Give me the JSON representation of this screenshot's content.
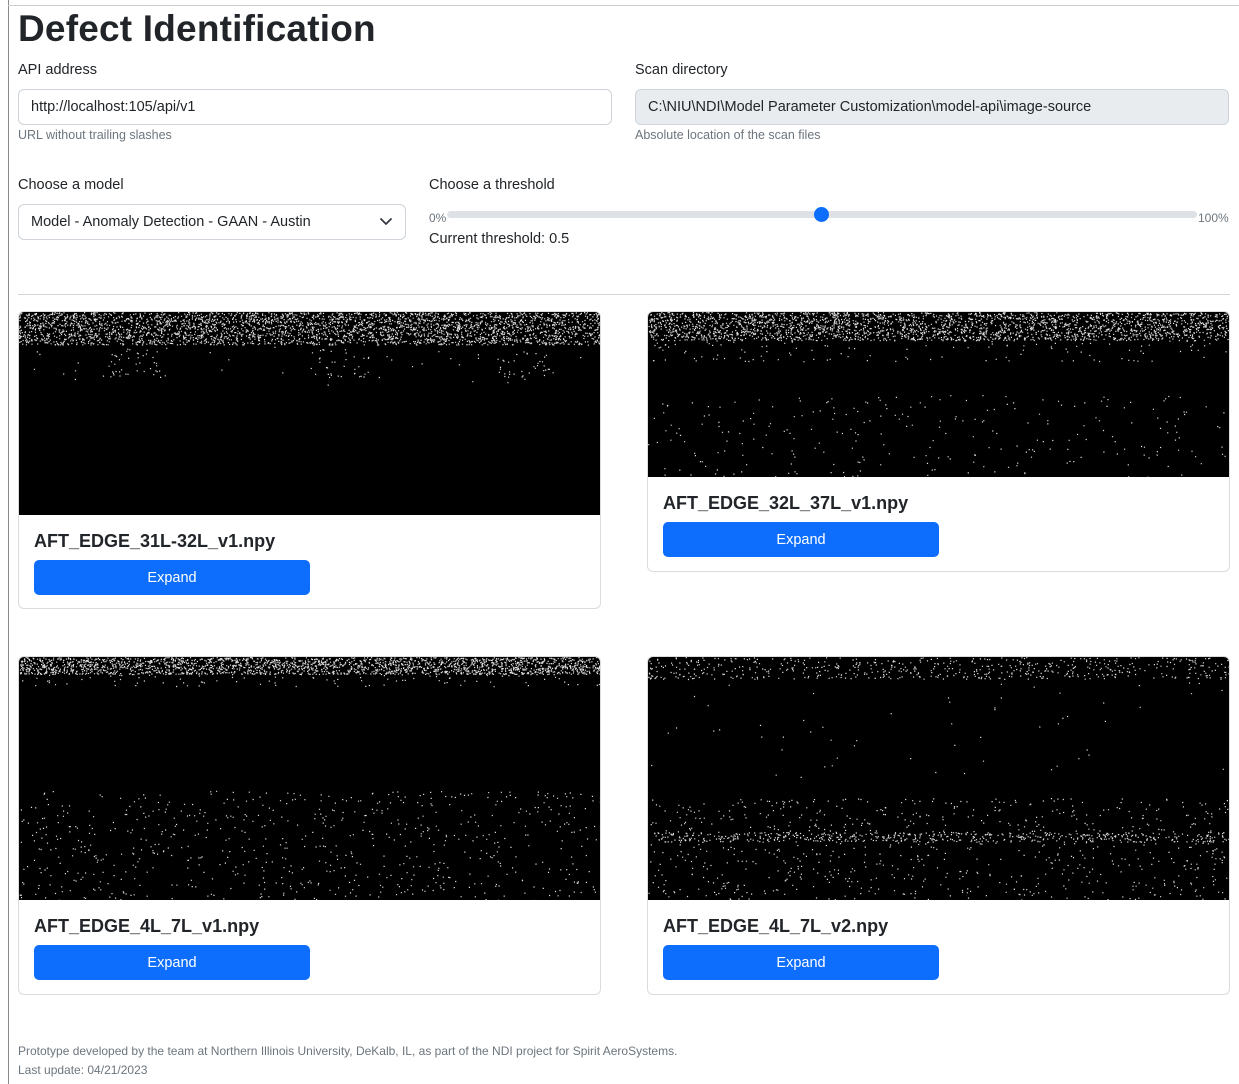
{
  "page": {
    "title": "Defect Identification"
  },
  "api": {
    "label": "API address",
    "value": "http://localhost:105/api/v1",
    "help": "URL without trailing slashes"
  },
  "scan": {
    "label": "Scan directory",
    "value": "C:\\NIU\\NDI\\Model Parameter Customization\\model-api\\image-source",
    "help": "Absolute location of the scan files"
  },
  "model": {
    "label": "Choose a model",
    "selected": "Model - Anomaly Detection - GAAN - Austin",
    "icon": "chevron-down-icon"
  },
  "threshold": {
    "label": "Choose a threshold",
    "min_label": "0%",
    "max_label": "100%",
    "value": 0.5,
    "current_text": "Current threshold: 0.5"
  },
  "cards": [
    {
      "title": "AFT_EDGE_31L-32L_v1.npy",
      "button": "Expand"
    },
    {
      "title": "AFT_EDGE_32L_37L_v1.npy",
      "button": "Expand"
    },
    {
      "title": "AFT_EDGE_4L_7L_v1.npy",
      "button": "Expand"
    },
    {
      "title": "AFT_EDGE_4L_7L_v2.npy",
      "button": "Expand"
    }
  ],
  "footer": {
    "line1": "Prototype developed by the team at Northern Illinois University, DeKalb, IL, as part of the NDI project for Spirit AeroSystems.",
    "line2": "Last update: 04/21/2023"
  },
  "colors": {
    "primary": "#0d6efd",
    "scan_bg": "#000000",
    "scan_dots": "#dddddd"
  }
}
